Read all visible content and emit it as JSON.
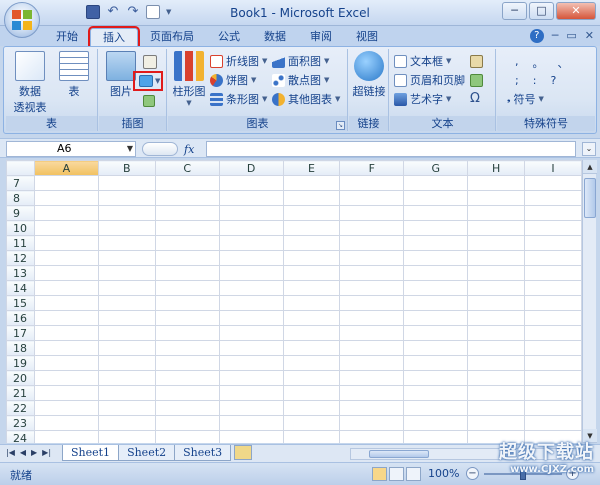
{
  "window": {
    "title": "Book1 - Microsoft Excel",
    "minimize": "─",
    "maximize": "□",
    "close": "✕"
  },
  "tabs": [
    {
      "label": "开始"
    },
    {
      "label": "插入"
    },
    {
      "label": "页面布局"
    },
    {
      "label": "公式"
    },
    {
      "label": "数据"
    },
    {
      "label": "审阅"
    },
    {
      "label": "视图"
    }
  ],
  "ribbon": {
    "tables_group": {
      "label": "表",
      "pivot_line1": "数据",
      "pivot_line2": "透视表",
      "table": "表"
    },
    "illustrations_group": {
      "label": "插图",
      "picture": "图片"
    },
    "charts_group": {
      "label": "图表",
      "column": "柱形图",
      "line": "折线图",
      "pie": "饼图",
      "bar": "条形图",
      "area": "面积图",
      "scatter": "散点图",
      "other": "其他图表"
    },
    "links_group": {
      "label": "链接",
      "hyperlink": "超链接"
    },
    "text_group": {
      "label": "文本",
      "textbox": "文本框",
      "header_footer": "页眉和页脚",
      "wordart": "艺术字"
    },
    "symbols_group": {
      "label": "特殊符号",
      "symbol": "符号",
      "omega": "Ω"
    }
  },
  "formula_bar": {
    "name_box": "A6",
    "fx": "fx",
    "formula_value": ""
  },
  "grid": {
    "columns": [
      "A",
      "B",
      "C",
      "D",
      "E",
      "F",
      "G",
      "H",
      "I"
    ],
    "rows": [
      "7",
      "8",
      "9",
      "10",
      "11",
      "12",
      "13",
      "14",
      "15",
      "16",
      "17",
      "18",
      "19",
      "20",
      "21",
      "22",
      "23",
      "24"
    ]
  },
  "sheets": [
    {
      "label": "Sheet1"
    },
    {
      "label": "Sheet2"
    },
    {
      "label": "Sheet3"
    }
  ],
  "status": {
    "ready": "就绪",
    "zoom": "100%"
  },
  "watermark": {
    "line1": "超级下载站",
    "line2": "www.CJXZ.com"
  }
}
